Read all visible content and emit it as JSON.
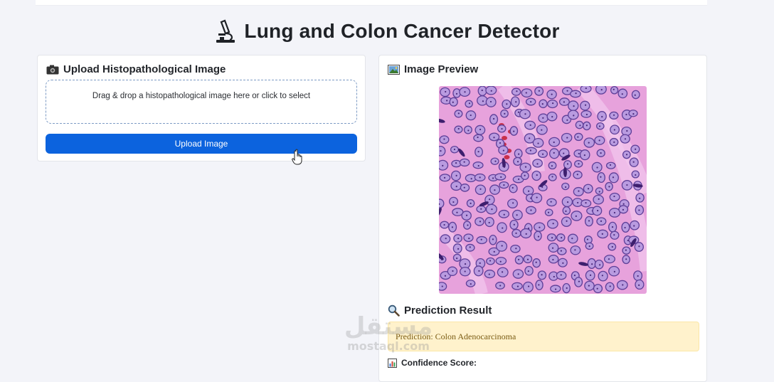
{
  "app": {
    "title": "Lung and Colon Cancer Detector",
    "title_icon": "microscope-icon"
  },
  "upload_card": {
    "header_icon": "camera-icon",
    "header": "Upload Histopathological Image",
    "dropzone_text": "Drag & drop a histopathological image here or click to select",
    "button_label": "Upload Image"
  },
  "preview_card": {
    "header_icon": "picture-icon",
    "header": "Image Preview",
    "prediction_icon": "magnifier-icon",
    "prediction_header": "Prediction Result",
    "prediction_text": "Prediction: Colon Adenocarcinoma",
    "confidence_icon": "bar-chart-icon",
    "confidence_label": "Confidence Score:"
  },
  "watermark": {
    "arabic": "مستقل",
    "latin": "mostaql.com"
  },
  "colors": {
    "accent": "#0c63de",
    "background": "#f3f4f9",
    "prediction_bg": "#fff2cc",
    "prediction_text": "#7a5b12",
    "tissue_bg": "#e7a2dc",
    "nucleus": "#8e6bc2"
  }
}
